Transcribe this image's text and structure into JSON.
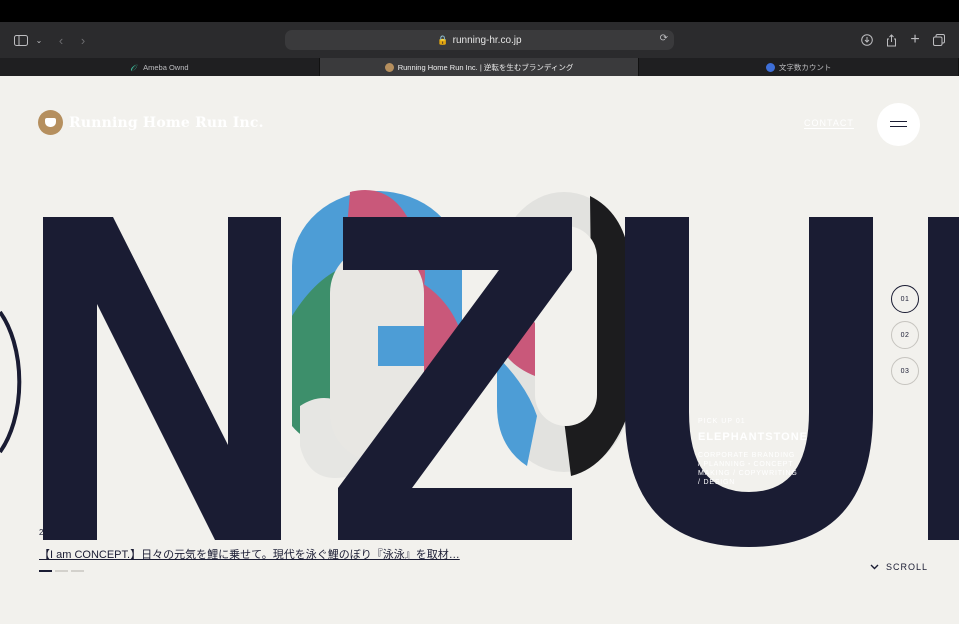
{
  "browser": {
    "url": "running-hr.co.jp",
    "tabs": [
      {
        "label": "Ameba Ownd",
        "active": false
      },
      {
        "label": "Running Home Run Inc. | 逆転を生むブランディング",
        "active": true
      },
      {
        "label": "文字数カウント",
        "active": false
      }
    ]
  },
  "header": {
    "logo_text": "Running Home Run Inc.",
    "contact_label": "CONTACT"
  },
  "hero": {
    "letters": [
      "N",
      "Z",
      "U"
    ],
    "pager": [
      "01",
      "02",
      "03"
    ],
    "pickup": {
      "label": "PICK UP 01",
      "title": "ELEPHANTSTONE",
      "details": "CORPORATE BRANDING / PLANNING・CONCEPT MAKING / COPYWRITING / DESIGN"
    }
  },
  "news": {
    "date": "2",
    "headline": "【I am CONCEPT.】日々の元気を鯉に乗せて。現代を泳ぐ鯉のぼり『泳泳』を取材…"
  },
  "scroll_label": "SCROLL",
  "colors": {
    "navy": "#1a1c33",
    "blue": "#4d9dd6",
    "pink": "#c9587a",
    "green": "#3d8f6b",
    "background": "#f2f1ed"
  }
}
